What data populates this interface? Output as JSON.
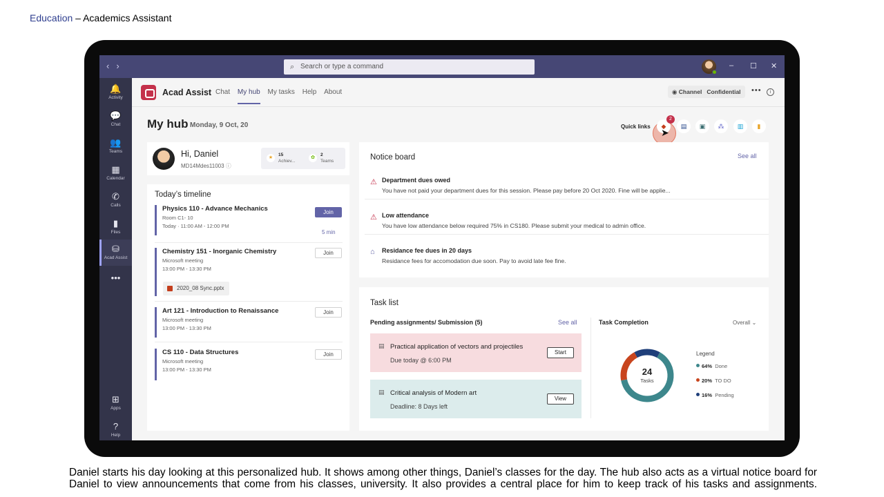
{
  "slide": {
    "title_link": "Education",
    "title_rest": " – Academics Assistant",
    "caption": "Daniel starts his day looking at this personalized hub. It shows among other things, Daniel’s classes for the day.  The hub also acts as a virtual notice board for Daniel to view announcements that come from his classes, university. It also provides a central place for him to keep track of his tasks and assignments."
  },
  "titlebar": {
    "back": "‹",
    "forward": "›",
    "search_placeholder": "Search or type a command",
    "minimize": "–",
    "maximize": "☐",
    "close": "✕"
  },
  "rail": {
    "items": [
      {
        "label": "Activity",
        "icon": "bell-icon",
        "glyph": "🔔"
      },
      {
        "label": "Chat",
        "icon": "chat-icon",
        "glyph": "💬"
      },
      {
        "label": "Teams",
        "icon": "teams-icon",
        "glyph": "👥"
      },
      {
        "label": "Calendar",
        "icon": "calendar-icon",
        "glyph": "▦"
      },
      {
        "label": "Calls",
        "icon": "phone-icon",
        "glyph": "✆"
      },
      {
        "label": "Files",
        "icon": "file-icon",
        "glyph": "▮"
      },
      {
        "label": "Acad Assist",
        "icon": "bot-icon",
        "glyph": "⛁"
      }
    ],
    "more": "•••",
    "apps_label": "Apps",
    "help_label": "Help"
  },
  "app": {
    "name": "Acad Assist",
    "tabs": [
      "Chat",
      "My hub",
      "My tasks",
      "Help",
      "About"
    ],
    "active_tab": "My hub",
    "channel_label": "Channel",
    "channel_value": "Confidential",
    "more": "•••",
    "info": "i"
  },
  "hub": {
    "title": "My hub",
    "date": "Monday, 9 Oct, 20",
    "quick_links_label": "Quick links",
    "quick_links_badge": "2"
  },
  "profile": {
    "greeting": "Hi, Daniel",
    "id": "MD14Mdes11003",
    "achievements_count": "15",
    "achievements_label": "Achiev...",
    "teams_count": "2",
    "teams_label": "Teams"
  },
  "timeline": {
    "title": "Today’s timeline",
    "items": [
      {
        "name": "Physics 110 - Advance Mechanics",
        "line1": "Room C1- 10",
        "line2": "Today · 11:00 AM - 12:00 PM",
        "button": "Join",
        "note": "5 min"
      },
      {
        "name": "Chemistry 151 - Inorganic Chemistry",
        "line1": "Microsoft meeting",
        "line2": "13:00 PM - 13:30 PM",
        "button": "Join",
        "attachment": "2020_08 Sync.pptx"
      },
      {
        "name": "Art 121 - Introduction to Renaissance",
        "line1": "Microsoft meeting",
        "line2": "13:00 PM - 13:30 PM",
        "button": "Join"
      },
      {
        "name": "CS 110 - Data Structures",
        "line1": "Microsoft meeting",
        "line2": "13:00 PM - 13:30 PM",
        "button": "Join"
      }
    ]
  },
  "notice": {
    "title": "Notice board",
    "see_all": "See all",
    "items": [
      {
        "title": "Department dues owed",
        "text": "You have not paid your department dues for this session. Please pay before 20 Oct 2020. Fine will be applie...",
        "icon": "warning-icon"
      },
      {
        "title": "Low attendance",
        "text": "You have low attendance below required 75% in CS180. Please submit your medical to admin office.",
        "icon": "warning-icon"
      },
      {
        "title": "Residance fee dues in 20 days",
        "text": "Residance fees for accomodation due soon. Pay to avoid late fee fine.",
        "icon": "home-icon"
      }
    ]
  },
  "tasks": {
    "title": "Task list",
    "pending_label": "Pending assignments/ Submission (5)",
    "see_all": "See all",
    "items": [
      {
        "title": "Practical application of vectors and projectiles",
        "detail": "Due today @ 6:00 PM",
        "button": "Start",
        "color": "#f7dcdf"
      },
      {
        "title": "Critical analysis of Modern art",
        "detail": "Deadline: 8 Days left",
        "button": "View",
        "color": "#dcecec"
      }
    ],
    "completion_title": "Task Completion",
    "filter": "Overall ⌄",
    "total": "24",
    "total_label": "Tasks",
    "legend_title": "Legend",
    "legend": [
      {
        "pct": "64%",
        "label": "Done",
        "value": 64,
        "color": "#3d878c"
      },
      {
        "pct": "20%",
        "label": "TO DO",
        "value": 20,
        "color": "#c8451e"
      },
      {
        "pct": "16%",
        "label": "Pending",
        "value": 16,
        "color": "#1f3f7a"
      }
    ]
  },
  "colors": {
    "brand": "#464775",
    "accent": "#6264a7",
    "alert": "#c4314b"
  }
}
